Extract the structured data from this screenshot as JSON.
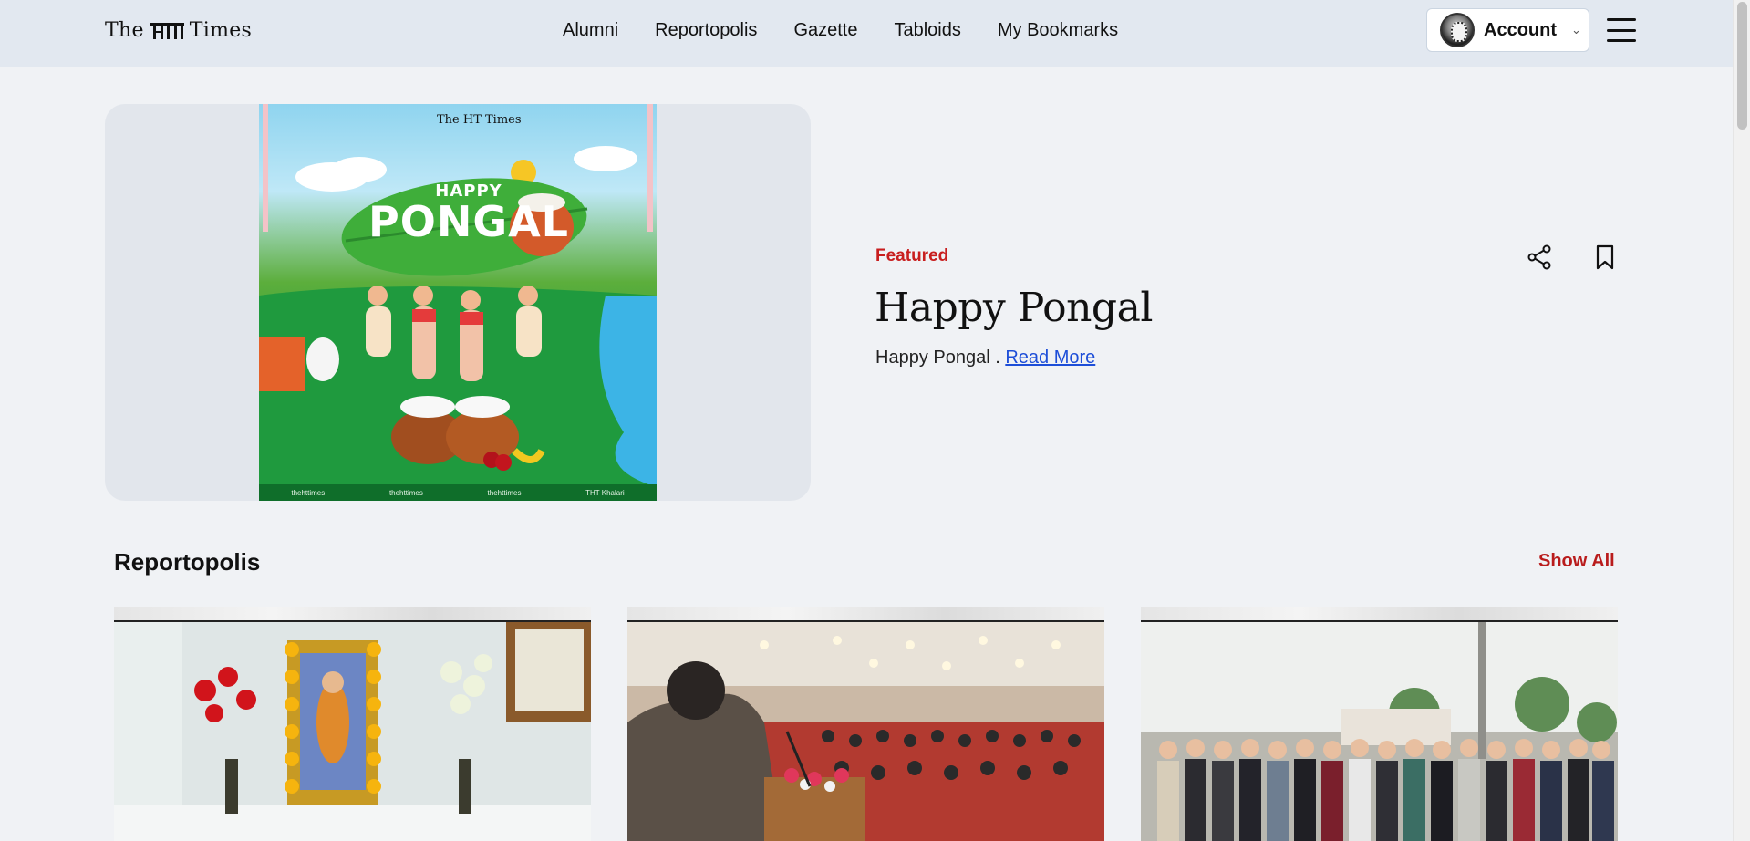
{
  "header": {
    "logo_prefix": "The",
    "logo_suffix": "Times",
    "nav": [
      "Alumni",
      "Reportopolis",
      "Gazette",
      "Tabloids",
      "My Bookmarks"
    ],
    "account_label": "Account"
  },
  "featured": {
    "tag": "Featured",
    "title": "Happy Pongal",
    "description": "Happy Pongal .",
    "read_more": "Read More",
    "poster": {
      "brand": "The HT Times",
      "happy": "HAPPY",
      "pongal": "PONGAL",
      "socials": [
        "thehttimes",
        "thehttimes",
        "thehttimes",
        "THT Khalari"
      ]
    }
  },
  "reportopolis": {
    "title": "Reportopolis",
    "show_all": "Show All"
  },
  "colors": {
    "accent_red": "#c81e1e",
    "link_blue": "#1d4ed8",
    "header_bg": "#e2e8f0"
  }
}
